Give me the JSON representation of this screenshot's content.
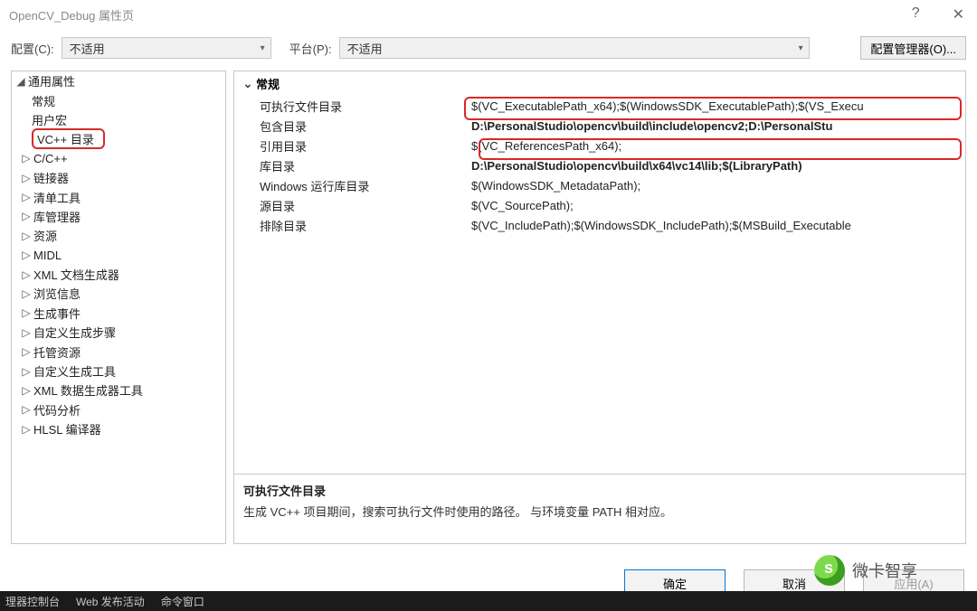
{
  "window": {
    "title": "OpenCV_Debug 属性页"
  },
  "toolbar": {
    "config_label": "配置(C):",
    "config_value": "不适用",
    "platform_label": "平台(P):",
    "platform_value": "不适用",
    "config_manager": "配置管理器(O)..."
  },
  "sidebar": {
    "root": "通用属性",
    "items": [
      {
        "label": "常规",
        "expand": ""
      },
      {
        "label": "用户宏",
        "expand": ""
      },
      {
        "label": "VC++ 目录",
        "expand": "",
        "selected": true
      },
      {
        "label": "C/C++",
        "expand": "▷"
      },
      {
        "label": "链接器",
        "expand": "▷"
      },
      {
        "label": "清单工具",
        "expand": "▷"
      },
      {
        "label": "库管理器",
        "expand": "▷"
      },
      {
        "label": "资源",
        "expand": "▷"
      },
      {
        "label": "MIDL",
        "expand": "▷"
      },
      {
        "label": "XML 文档生成器",
        "expand": "▷"
      },
      {
        "label": "浏览信息",
        "expand": "▷"
      },
      {
        "label": "生成事件",
        "expand": "▷"
      },
      {
        "label": "自定义生成步骤",
        "expand": "▷"
      },
      {
        "label": "托管资源",
        "expand": "▷"
      },
      {
        "label": "自定义生成工具",
        "expand": "▷"
      },
      {
        "label": "XML 数据生成器工具",
        "expand": "▷"
      },
      {
        "label": "代码分析",
        "expand": "▷"
      },
      {
        "label": "HLSL 编译器",
        "expand": "▷"
      }
    ]
  },
  "section": {
    "title": "常规"
  },
  "props": [
    {
      "label": "可执行文件目录",
      "value": "$(VC_ExecutablePath_x64);$(WindowsSDK_ExecutablePath);$(VS_Execu",
      "bold": false
    },
    {
      "label": "包含目录",
      "value": "D:\\PersonalStudio\\opencv\\build\\include\\opencv2;D:\\PersonalStu",
      "bold": true
    },
    {
      "label": "引用目录",
      "value": "$(VC_ReferencesPath_x64);",
      "bold": false
    },
    {
      "label": "库目录",
      "value": "D:\\PersonalStudio\\opencv\\build\\x64\\vc14\\lib;$(LibraryPath)",
      "bold": true
    },
    {
      "label": "Windows 运行库目录",
      "value": "$(WindowsSDK_MetadataPath);",
      "bold": false
    },
    {
      "label": "源目录",
      "value": "$(VC_SourcePath);",
      "bold": false
    },
    {
      "label": "排除目录",
      "value": "$(VC_IncludePath);$(WindowsSDK_IncludePath);$(MSBuild_Executable",
      "bold": false
    }
  ],
  "descPane": {
    "title": "可执行文件目录",
    "body": "生成 VC++ 项目期间，搜索可执行文件时使用的路径。   与环境变量 PATH 相对应。"
  },
  "buttons": {
    "ok": "确定",
    "cancel": "取消",
    "apply": "应用(A)"
  },
  "status": {
    "a": "理器控制台",
    "b": "Web 发布活动",
    "c": "命令窗口"
  },
  "watermark": "微卡智享"
}
